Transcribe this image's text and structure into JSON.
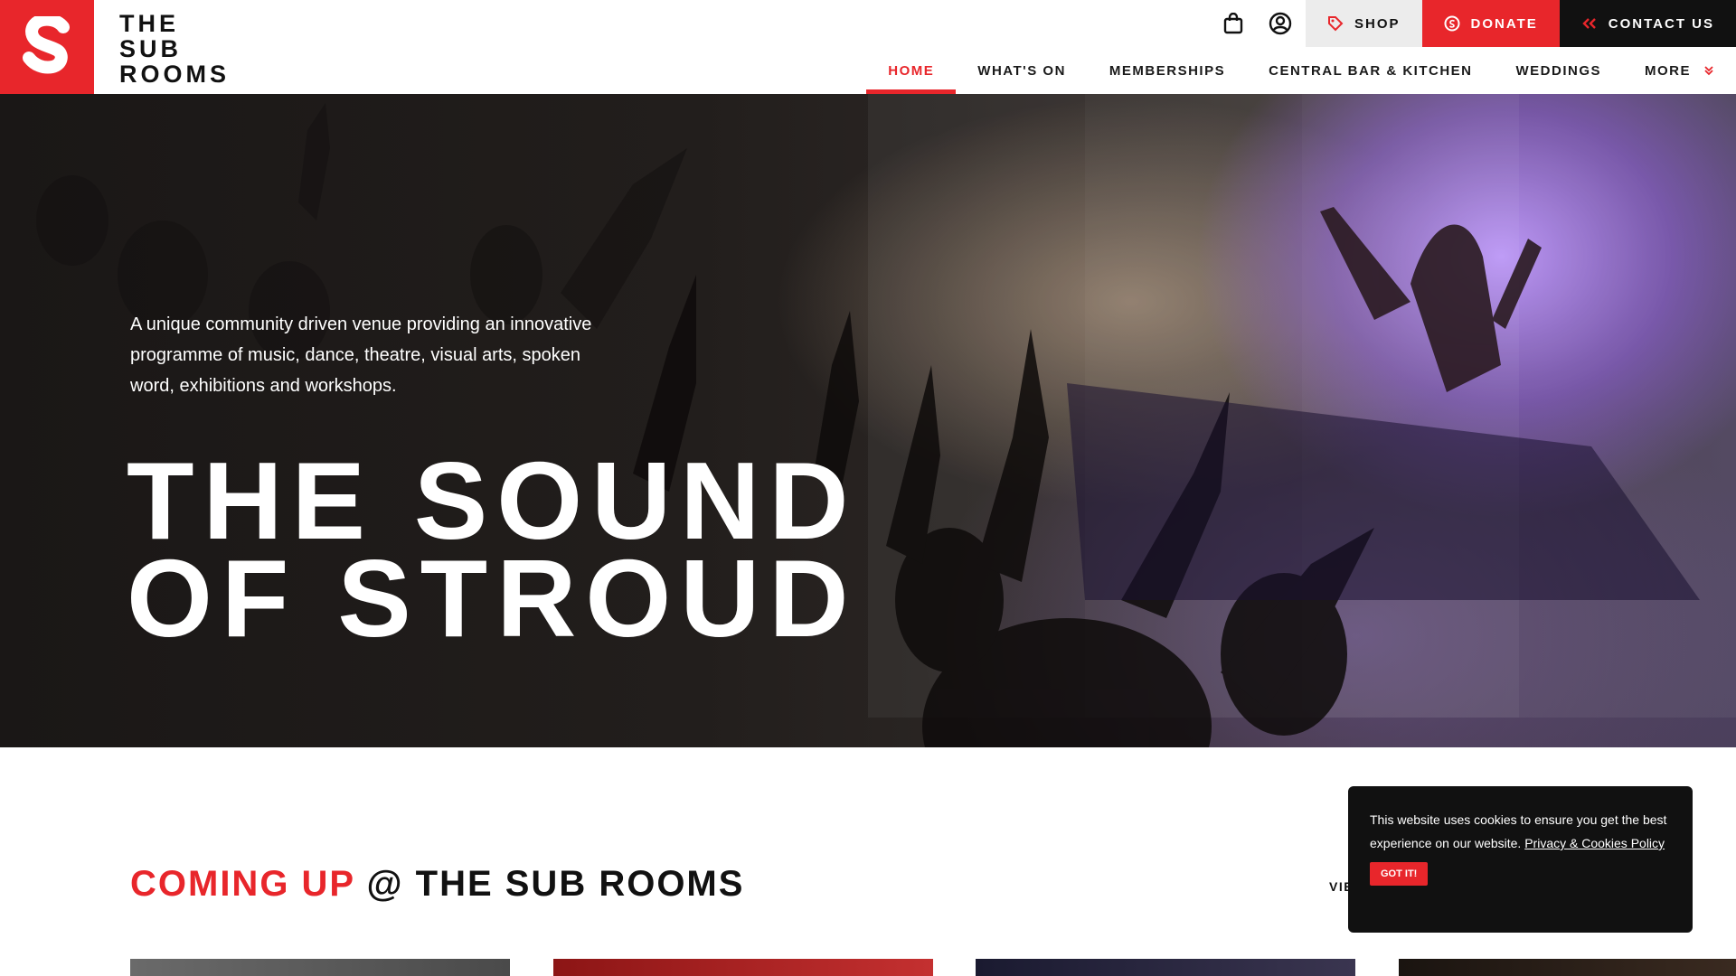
{
  "brand": {
    "logo_letter": "S",
    "name_lines": [
      "THE",
      "SUB",
      "ROOMS"
    ],
    "accent_color": "#e8262b"
  },
  "utility": {
    "basket_icon": "shopping-bag-icon",
    "account_icon": "user-circle-icon",
    "shop_label": "SHOP",
    "shop_icon": "tag-icon",
    "donate_label": "DONATE",
    "donate_icon": "donate-coin-icon",
    "contact_label": "CONTACT US",
    "contact_icon": "chevrons-left-icon"
  },
  "nav": {
    "items": [
      {
        "label": "HOME",
        "active": true
      },
      {
        "label": "WHAT'S ON"
      },
      {
        "label": "MEMBERSHIPS"
      },
      {
        "label": "CENTRAL BAR & KITCHEN"
      },
      {
        "label": "WEDDINGS"
      },
      {
        "label": "MORE",
        "icon": "chevron-down-icon"
      }
    ]
  },
  "hero": {
    "tagline": "A unique community driven venue providing an innovative programme of music, dance, theatre, visual arts, spoken word, exhibitions and workshops.",
    "title_line1": "THE SOUND",
    "title_line2": "OF STROUD"
  },
  "coming_up": {
    "heading_accent": "COMING UP",
    "heading_rest": "@ THE SUB ROOMS",
    "view_all_label": "VIE"
  },
  "cookie": {
    "text": "This website uses cookies to ensure you get the best experience on our website.",
    "link_label": "Privacy & Cookies Policy",
    "button_label": "GOT IT!"
  }
}
